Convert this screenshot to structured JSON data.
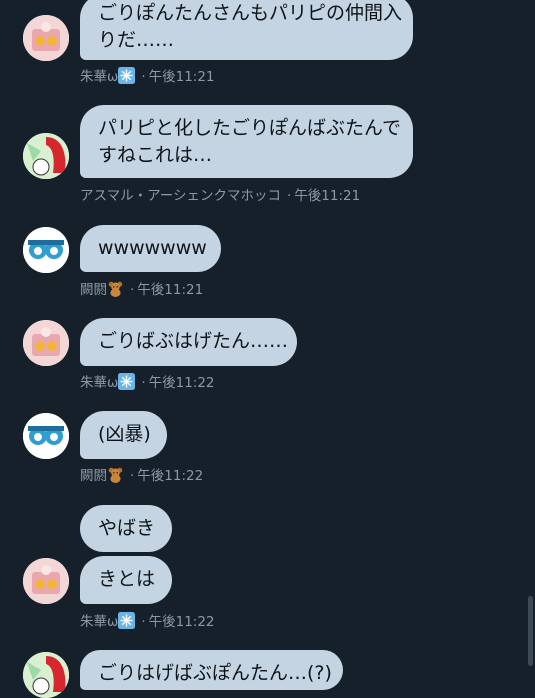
{
  "messages": [
    {
      "lines": [
        "ごりぽんたんさんもパリピの仲間入",
        "りだ……"
      ],
      "author": "朱華ω",
      "author_icon": "snowflake-icon",
      "time": "午後11:21",
      "avatar": "avatar-pink"
    },
    {
      "lines": [
        "パリピと化したごりぽんばぶたんで",
        "すねこれは…"
      ],
      "author": "アスマル・アーシェンクマホッコ",
      "author_icon": "",
      "time": "午後11:21",
      "avatar": "avatar-red"
    },
    {
      "lines": [
        "wwwwwww"
      ],
      "author": "闕閼",
      "author_icon": "teddy-bear-icon",
      "time": "午後11:21",
      "avatar": "avatar-blue"
    },
    {
      "lines": [
        "ごりばぶはげたん……"
      ],
      "author": "朱華ω",
      "author_icon": "snowflake-icon",
      "time": "午後11:22",
      "avatar": "avatar-pink"
    },
    {
      "lines": [
        "(凶暴)"
      ],
      "author": "闕閼",
      "author_icon": "teddy-bear-icon",
      "time": "午後11:22",
      "avatar": "avatar-blue"
    },
    {
      "lines": [
        "やばき"
      ],
      "author": "",
      "author_icon": "",
      "time": "",
      "avatar": ""
    },
    {
      "lines": [
        "きとは"
      ],
      "author": "朱華ω",
      "author_icon": "snowflake-icon",
      "time": "午後11:22",
      "avatar": "avatar-pink"
    },
    {
      "lines": [
        "ごりはげばぶぽんたん…(?)"
      ],
      "author": "",
      "author_icon": "",
      "time": "",
      "avatar": "avatar-red"
    }
  ],
  "colors": {
    "background": "#15202b",
    "bubble": "#c4d4e2",
    "meta_text": "#8b98a5"
  }
}
